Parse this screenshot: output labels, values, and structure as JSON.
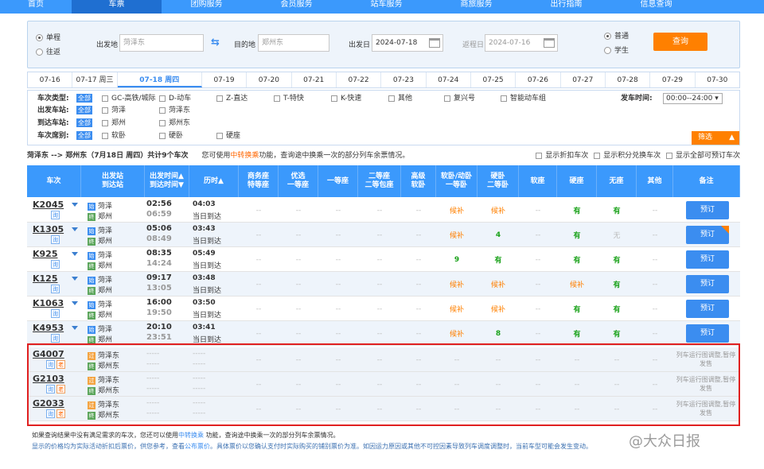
{
  "nav": {
    "items": [
      "首页",
      "车票",
      "团购服务",
      "会员服务",
      "站车服务",
      "商旅服务",
      "出行指南",
      "信息查询"
    ]
  },
  "search": {
    "one_way": "单程",
    "round_trip": "往返",
    "from_label": "出发地",
    "from_value": "菏泽东",
    "to_label": "目的地",
    "to_value": "郑州东",
    "depart_label": "出发日",
    "depart_value": "2024-07-18",
    "return_label": "返程日",
    "return_value": "2024-07-16",
    "normal": "普通",
    "student": "学生",
    "query": "查询"
  },
  "dates": [
    "07-16",
    "07-17 周三",
    "07-18 周四",
    "07-19",
    "07-20",
    "07-21",
    "07-22",
    "07-23",
    "07-24",
    "07-25",
    "07-26",
    "07-27",
    "07-28",
    "07-29",
    "07-30"
  ],
  "filter": {
    "type_label": "车次类型:",
    "all": "全部",
    "types": [
      "GC-高铁/城际",
      "D-动车",
      "Z-直达",
      "T-特快",
      "K-快速",
      "其他",
      "复兴号",
      "智能动车组"
    ],
    "time_label": "发车时间:",
    "time_value": "00:00--24:00",
    "from_label": "出发车站:",
    "from_opts": [
      "菏泽",
      "菏泽东"
    ],
    "to_label": "到达车站:",
    "to_opts": [
      "郑州",
      "郑州东"
    ],
    "seat_label": "车次席别:",
    "seat_opts": [
      "软卧",
      "硬卧",
      "硬座"
    ],
    "fold": "筛选"
  },
  "info": {
    "route": "菏泽东 --> 郑州东（7月18日 周四）共计9个车次",
    "tip_pre": "您可使用",
    "tip_link": "中转换乘",
    "tip_post": "功能，查询途中换乘一次的部分列车余票情况。",
    "opt1": "显示折扣车次",
    "opt2": "显示积分兑换车次",
    "opt3": "显示全部可预订车次"
  },
  "headers": {
    "train": "车次",
    "station": "出发站\n到达站",
    "time": "出发时间▲\n到达时间▼",
    "dur": "历时▲",
    "biz": "商务座\n特等座",
    "prem": "优选\n一等座",
    "first": "一等座",
    "second": "二等座\n二等包座",
    "adv": "高级\n软卧",
    "soft": "软卧/动卧\n一等卧",
    "hard": "硬卧\n二等卧",
    "softseat": "软座",
    "hardseat": "硬座",
    "none": "无座",
    "other": "其他",
    "remark": "备注"
  },
  "trains": [
    {
      "no": "K2045",
      "b1": "询",
      "from": "菏泽",
      "to": "郑州",
      "dep": "02:56",
      "arr": "06:59",
      "dur": "04:03",
      "day": "当日到达",
      "soft": "候补",
      "hard": "候补",
      "hardseat": "有",
      "none": "有",
      "book": "预订"
    },
    {
      "no": "K1305",
      "b1": "询",
      "from": "菏泽",
      "to": "郑州",
      "dep": "05:06",
      "arr": "08:49",
      "dur": "03:43",
      "day": "当日到达",
      "soft": "候补",
      "hard": "4",
      "hardseat": "有",
      "none": "无",
      "book": "预订",
      "corner": true
    },
    {
      "no": "K925",
      "b1": "询",
      "from": "菏泽",
      "to": "郑州",
      "dep": "08:35",
      "arr": "14:24",
      "dur": "05:49",
      "day": "当日到达",
      "soft": "9",
      "hard": "有",
      "hardseat": "有",
      "none": "有",
      "book": "预订"
    },
    {
      "no": "K125",
      "b1": "询",
      "from": "菏泽",
      "to": "郑州",
      "dep": "09:17",
      "arr": "13:05",
      "dur": "03:48",
      "day": "当日到达",
      "soft": "候补",
      "hard": "候补",
      "hardseat": "候补",
      "none": "有",
      "book": "预订"
    },
    {
      "no": "K1063",
      "b1": "询",
      "from": "菏泽",
      "to": "郑州",
      "dep": "16:00",
      "arr": "19:50",
      "dur": "03:50",
      "day": "当日到达",
      "soft": "候补",
      "hard": "候补",
      "hardseat": "有",
      "none": "有",
      "book": "预订"
    },
    {
      "no": "K4953",
      "b1": "询",
      "from": "菏泽",
      "to": "郑州",
      "dep": "20:10",
      "arr": "23:51",
      "dur": "03:41",
      "day": "当日到达",
      "soft": "候补",
      "hard": "8",
      "hardseat": "有",
      "none": "有",
      "book": "预订"
    }
  ],
  "suspended": [
    {
      "no": "G4007",
      "b1": "询",
      "b2": "老",
      "from": "菏泽东",
      "to": "郑州东",
      "remark": "列车运行图调整,暂停发售"
    },
    {
      "no": "G2103",
      "b1": "询",
      "b2": "老",
      "from": "菏泽东",
      "to": "郑州东",
      "remark": "列车运行图调整,暂停发售"
    },
    {
      "no": "G2033",
      "b1": "询",
      "b2": "老",
      "from": "菏泽东",
      "to": "郑州东",
      "remark": "列车运行图调整,暂停发售"
    }
  ],
  "dash": "--",
  "time_dash": "-----",
  "foot": {
    "l1_pre": "如果查询结果中没有满足需求的车次，您还可以使用",
    "l1_link": "中转换乘",
    "l1_post": " 功能，查询途中换乘一次的部分列车余票情况。",
    "l2_pre": "显示的价格均为实际活动折扣后票价，供您参考，查看",
    "l2_link": "公布票价",
    "l2_post": "。具体票价以您确认支付时实际购买的铺别票价为准。如因运力原因或其他不可控因素导致列车调度调整时，当前车型可能会发生变动。"
  },
  "watermark": "@大众日报",
  "colors": {
    "brand": "#3b99fc",
    "accent": "#ff8000",
    "available": "#1aa21a",
    "highlight_box": "#e02020"
  }
}
